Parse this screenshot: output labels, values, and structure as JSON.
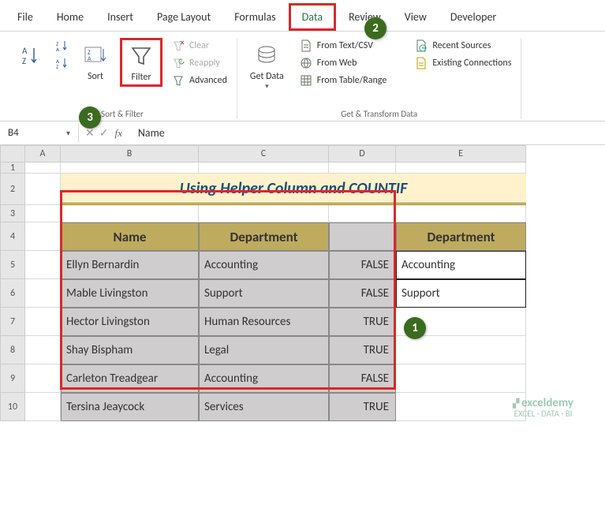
{
  "ribbon": {
    "tabs": [
      "File",
      "Home",
      "Insert",
      "Page Layout",
      "Formulas",
      "Data",
      "Review",
      "View",
      "Developer"
    ],
    "active_tab": "Data",
    "groups": {
      "sort_filter": {
        "label": "Sort & Filter",
        "sort": "Sort",
        "filter": "Filter",
        "clear": "Clear",
        "reapply": "Reapply",
        "advanced": "Advanced"
      },
      "get_transform": {
        "label": "Get & Transform Data",
        "get_data": "Get Data",
        "from_text": "From Text/CSV",
        "from_web": "From Web",
        "from_table": "From Table/Range",
        "recent": "Recent Sources",
        "existing": "Existing Connections"
      }
    }
  },
  "namebox": "B4",
  "formula_value": "Name",
  "col_widths": {
    "A": 45,
    "B": 175,
    "C": 165,
    "D": 85,
    "E": 165
  },
  "row_heights": {
    "1": 14,
    "2": 40,
    "3": 22,
    "data": 36
  },
  "sheet": {
    "title": "Using Helper Column and COUNTIF",
    "headers": {
      "b4": "Name",
      "c4": "Department",
      "e4": "Department"
    },
    "rows": [
      {
        "name": "Ellyn Bernardin",
        "dept": "Accounting",
        "flag": "FALSE",
        "lookup": "Accounting"
      },
      {
        "name": "Mable Livingston",
        "dept": "Support",
        "flag": "FALSE",
        "lookup": "Support"
      },
      {
        "name": "Hector Livingston",
        "dept": "Human Resources",
        "flag": "TRUE",
        "lookup": ""
      },
      {
        "name": "Shay Bispham",
        "dept": "Legal",
        "flag": "TRUE",
        "lookup": ""
      },
      {
        "name": "Carleton Treadgear",
        "dept": "Accounting",
        "flag": "FALSE",
        "lookup": ""
      },
      {
        "name": "Tersina Jeaycock",
        "dept": "Services",
        "flag": "TRUE",
        "lookup": ""
      }
    ]
  },
  "annotations": {
    "a1": "1",
    "a2": "2",
    "a3": "3"
  },
  "watermark": {
    "brand": "exceldemy",
    "tag": "EXCEL · DATA · BI"
  }
}
